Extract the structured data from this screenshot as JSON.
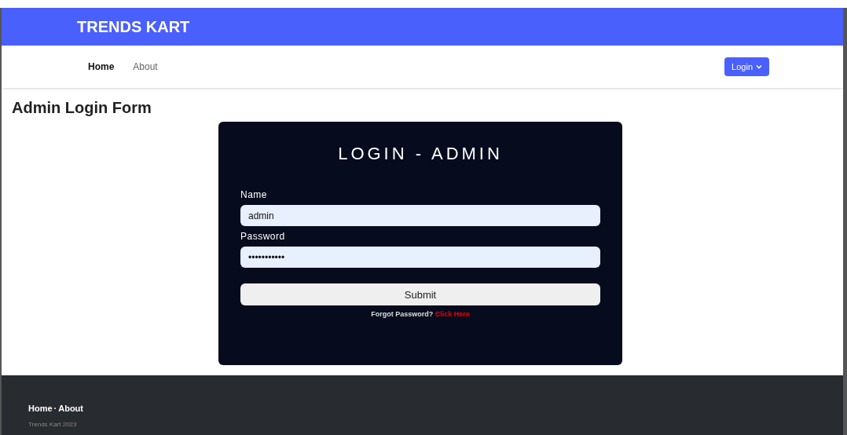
{
  "brand": "TRENDS KART",
  "nav": {
    "items": [
      {
        "label": "Home",
        "selected": true
      },
      {
        "label": "About",
        "selected": false
      }
    ],
    "login_button": "Login"
  },
  "page_title": "Admin Login Form",
  "login_card": {
    "title": "LOGIN - ADMIN",
    "fields": [
      {
        "label": "Name",
        "value": "admin"
      },
      {
        "label": "Password",
        "value": "•••••••••••"
      }
    ],
    "submit": "Submit",
    "forgot_text": "Forgot Password?",
    "forgot_link": "Click Here"
  },
  "footer": {
    "links": [
      "Home",
      "About"
    ],
    "separator": "·",
    "copyright": "Trends Kart 2023"
  }
}
